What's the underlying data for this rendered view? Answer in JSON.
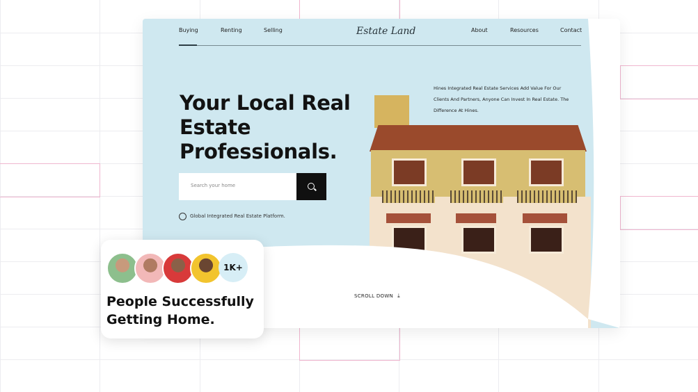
{
  "nav": {
    "left": [
      "Buying",
      "Renting",
      "Selling"
    ],
    "logo": "Estate Land",
    "right": [
      "About",
      "Resources",
      "Contact"
    ]
  },
  "hero": {
    "title": "Your Local Real Estate Professionals.",
    "search_placeholder": "Search your home",
    "platform": "Global Integrated Real Estate Platform.",
    "description": "Hines Integrated Real Estate Services Add Value For Our Clients And Partners, Anyone Can Invest In Real Estate. The Difference At Hines.",
    "scroll": "SCROLL DOWN"
  },
  "people": {
    "count": "1K+",
    "text": "People Successfully Getting Home."
  },
  "colors": {
    "hero_bg": "#cfe8f0",
    "accent_dark": "#101010",
    "grid_pink": "#f0b6cf"
  },
  "icons": [
    "search-icon",
    "globe-icon",
    "arrow-down-icon"
  ]
}
